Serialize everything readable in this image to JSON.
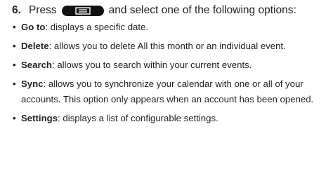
{
  "step": {
    "number": "6.",
    "text_before": "Press",
    "text_after": "and select one of the following options:",
    "key_icon": "menu-key-icon"
  },
  "options": [
    {
      "term": "Go to",
      "description": ": displays a specific date."
    },
    {
      "term": "Delete",
      "description": ": allows you to delete All this month or an individual event."
    },
    {
      "term": "Search",
      "description": ": allows you to search within your current events."
    },
    {
      "term": "Sync",
      "description": ": allows you to synchronize your calendar with one or all of your accounts. This option only appears when an account has been opened."
    },
    {
      "term": "Settings",
      "description": ": displays a list of configurable settings."
    }
  ],
  "colors": {
    "text": "#222222",
    "key_background": "#111111",
    "key_glyph": "#ffffff"
  }
}
